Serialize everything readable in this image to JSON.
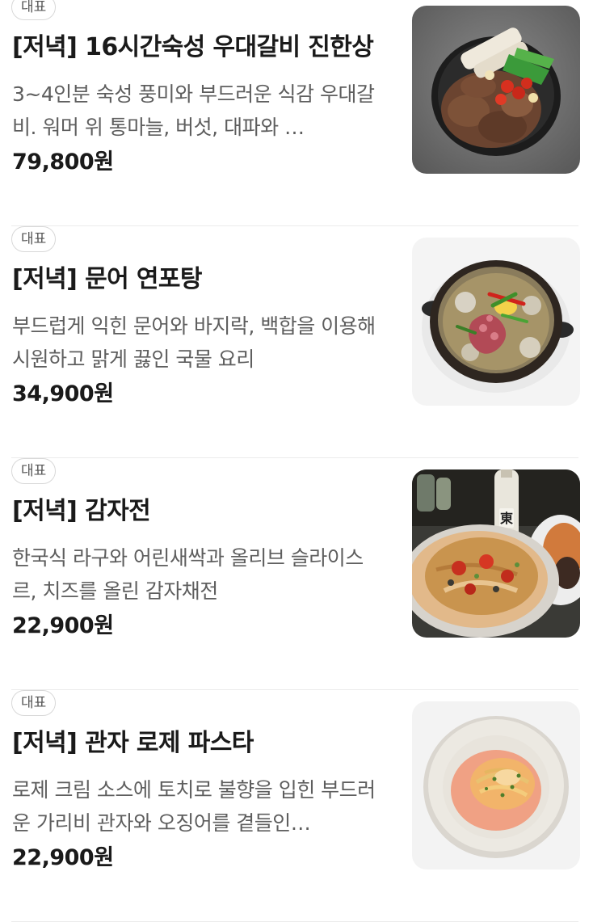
{
  "menu": {
    "items": [
      {
        "badge": "대표",
        "title": "[저녁] 16시간숙성 우대갈비 진한상",
        "description": "3~4인분 숙성 풍미와 부드러운 식감 우대갈비. 워머 위 통마늘, 버섯, 대파와 …",
        "price": "79,800원",
        "image_icon": "galbi-dish-photo"
      },
      {
        "badge": "대표",
        "title": "[저녁] 문어 연포탕",
        "description": "부드럽게 익힌 문어와 바지락, 백합을 이용해 시원하고 맑게 끓인 국물 요리",
        "price": "34,900원",
        "image_icon": "octopus-soup-photo"
      },
      {
        "badge": "대표",
        "title": "[저녁] 감자전",
        "description": "한국식 라구와 어린새싹과 올리브 슬라이스르, 치즈를 올린 감자채전",
        "price": "22,900원",
        "image_icon": "potato-pancake-photo"
      },
      {
        "badge": "대표",
        "title": "[저녁] 관자 로제 파스타",
        "description": "로제 크림 소스에 토치로 불향을 입힌 부드러운 가리비 관자와 오징어를 곁들인…",
        "price": "22,900원",
        "image_icon": "rose-pasta-photo"
      }
    ]
  }
}
